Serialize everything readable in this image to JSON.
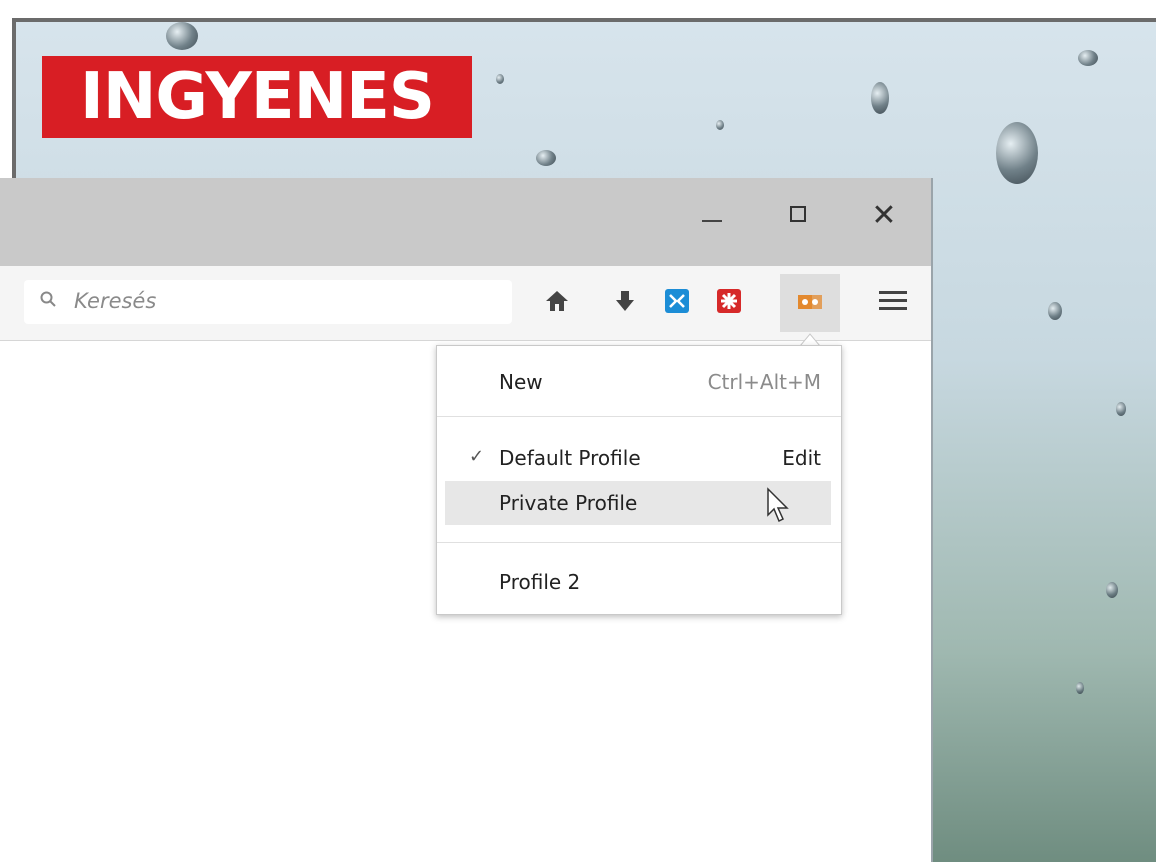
{
  "banner": {
    "text": "INGYENES"
  },
  "search": {
    "placeholder": "Keresés"
  },
  "window": {
    "controls": {
      "minimize": "",
      "maximize": "",
      "close": "✕"
    }
  },
  "profile_menu": {
    "new": {
      "label": "New",
      "shortcut": "Ctrl+Alt+M"
    },
    "items": [
      {
        "label": "Default Profile",
        "action": "Edit",
        "checked": true
      },
      {
        "label": "Private Profile",
        "hovered": true
      },
      {
        "label": "Profile 2"
      }
    ]
  },
  "colors": {
    "banner": "#d81e24",
    "ext1": "#1c8dd6",
    "ext2": "#d62929",
    "profile_icon": "#e3892f"
  },
  "icons": [
    "search-icon",
    "home-icon",
    "download-icon",
    "extension-icon",
    "addon-icon",
    "profile-switcher-icon",
    "hamburger-menu-icon",
    "checkmark-icon",
    "mouse-cursor-icon"
  ]
}
